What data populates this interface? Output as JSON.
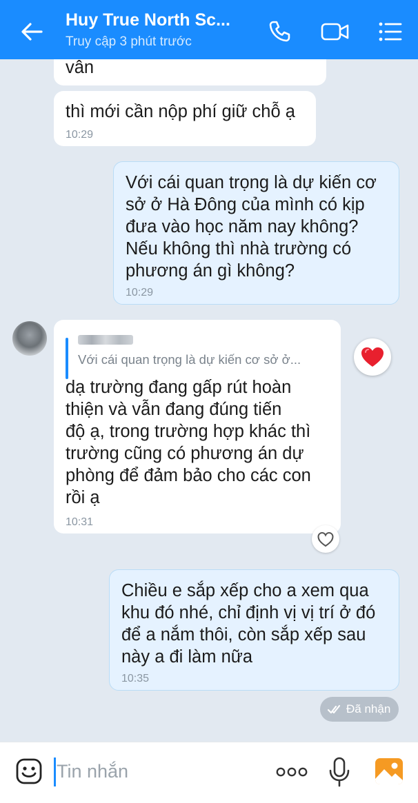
{
  "header": {
    "title": "Huy True North Sc...",
    "subtitle": "Truy cập 3 phút trước",
    "bg_color": "#1a8cff"
  },
  "messages": [
    {
      "id": "m0",
      "direction": "in",
      "text": "vẫn",
      "time": ""
    },
    {
      "id": "m1",
      "direction": "in",
      "text": "thì mới cần nộp phí giữ chỗ ạ",
      "time": "10:29"
    },
    {
      "id": "m2",
      "direction": "out",
      "text": "Với cái quan trọng là dự kiến cơ\nsở ở Hà Đông của mình có kịp\nđưa vào học năm nay không?\nNếu không thì nhà trường có\nphương án gì không?",
      "time": "10:29"
    },
    {
      "id": "m3",
      "direction": "in",
      "quote": {
        "text": "Với cái quan trọng là dự kiến cơ sở ở..."
      },
      "text": "dạ trường đang gấp rút hoàn\nthiện và vẫn đang đúng tiến\nđộ ạ, trong trường hợp khác thì\ntrường cũng có phương án dự\nphòng để đảm bảo cho các con\nrồi ạ",
      "time": "10:31",
      "reaction": "heart"
    },
    {
      "id": "m4",
      "direction": "out",
      "text": "Chiều e sắp xếp cho a xem qua\nkhu đó nhé, chỉ định vị vị trí ở đó\nđể a nắm thôi, còn sắp xếp sau\nnày a đi làm nữa",
      "time": "10:35"
    }
  ],
  "status": {
    "label": "Đã nhận"
  },
  "input": {
    "placeholder": "Tin nhắn"
  },
  "icons": {
    "back": "back-arrow-icon",
    "call": "phone-icon",
    "video": "video-call-icon",
    "menu": "menu-icon",
    "emoji": "emoji-icon",
    "more": "more-icon",
    "mic": "microphone-icon",
    "photo": "photo-icon",
    "heart": "heart-icon",
    "like": "heart-outline-icon",
    "check": "double-check-icon"
  }
}
